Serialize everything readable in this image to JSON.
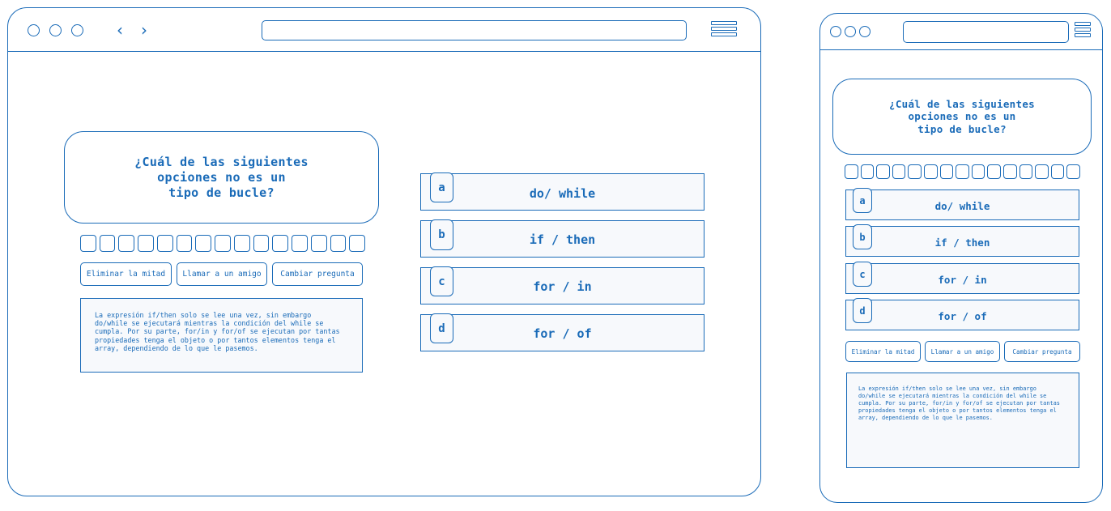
{
  "question": {
    "text": "¿Cuál de las siguientes\nopciones no es un\ntipo de bucle?"
  },
  "answers": [
    {
      "letter": "a",
      "label": "do/ while"
    },
    {
      "letter": "b",
      "label": "if / then"
    },
    {
      "letter": "c",
      "label": "for / in"
    },
    {
      "letter": "d",
      "label": "for / of"
    }
  ],
  "helpers": {
    "half": "Eliminar la mitad",
    "call": "Llamar a un amigo",
    "change": "Cambiar pregunta"
  },
  "explanation": "La expresión if/then solo se lee una vez, sin embargo\ndo/while se ejecutará mientras la condición del while se\ncumpla. Por su parte, for/in y for/of se ejecutan por tantas\npropiedades tenga el objeto o por tantos elementos tenga el\narray, dependiendo de lo que le pasemos.",
  "progress": {
    "total": 15
  },
  "colors": {
    "accent": "#1a6bb8",
    "panel": "#f7f9fc"
  },
  "icons": {
    "back": "chevron-left-icon",
    "forward": "chevron-right-icon",
    "menu": "hamburger-menu-icon"
  }
}
